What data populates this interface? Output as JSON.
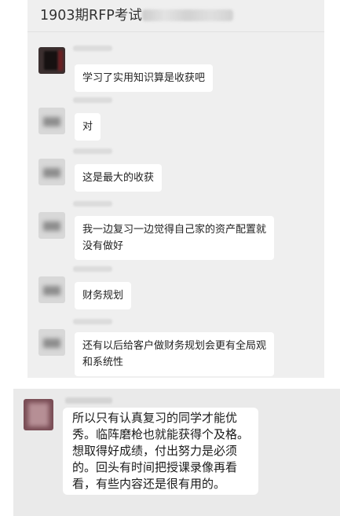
{
  "chat": {
    "title": "1903期RFP考试",
    "messages": [
      {
        "text": "学习了实用知识算是收获吧"
      },
      {
        "text": "对"
      },
      {
        "text": "这是最大的收获"
      },
      {
        "text": "我一边复习一边觉得自己家的资产配置就\n没有做好"
      },
      {
        "text": "财务规划"
      },
      {
        "text": "还有以后给客户做财务规划会更有全局观\n和系统性"
      }
    ]
  },
  "reply": {
    "text": "所以只有认真复习的同学才能优\n秀。临阵磨枪也就能获得个及格。\n想取得好成绩，付出努力是必须\n的。回头有时间把授课录像再看\n看，有些内容还是很有用的。"
  }
}
